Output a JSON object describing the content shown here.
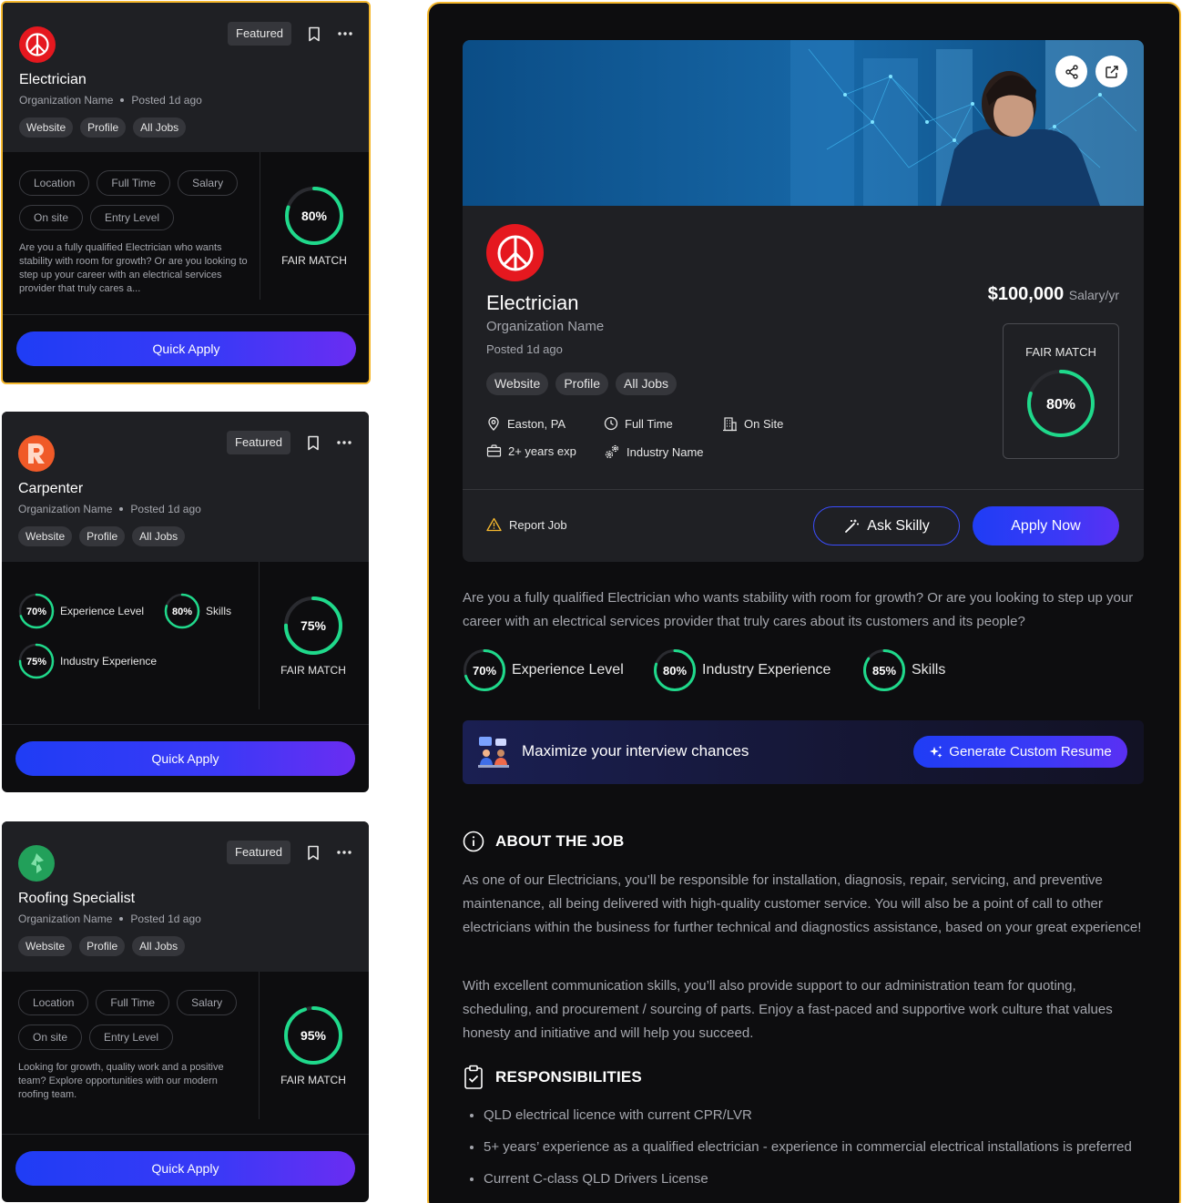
{
  "cards": [
    {
      "title": "Electrician",
      "org": "Organization Name",
      "posted": "Posted 1d ago",
      "featured": "Featured",
      "links": [
        "Website",
        "Profile",
        "All Jobs"
      ],
      "pills": [
        "Location",
        "Full Time",
        "Salary",
        "On site",
        "Entry Level"
      ],
      "description": "Are you a fully qualified Electrician who wants stability with room for growth? Or are you looking to step up your career with an electrical services provider that truly cares a...",
      "match_value": "80%",
      "match_fraction": 0.8,
      "match_label": "FAIR MATCH",
      "button": "Quick Apply",
      "logo_color": "#e5181f"
    },
    {
      "title": "Carpenter",
      "org": "Organization Name",
      "posted": "Posted 1d ago",
      "featured": "Featured",
      "links": [
        "Website",
        "Profile",
        "All Jobs"
      ],
      "skills": [
        {
          "value": "70%",
          "fraction": 0.7,
          "label": "Experience Level"
        },
        {
          "value": "80%",
          "fraction": 0.8,
          "label": "Skills"
        },
        {
          "value": "75%",
          "fraction": 0.75,
          "label": "Industry Experience"
        }
      ],
      "match_value": "75%",
      "match_fraction": 0.75,
      "match_label": "FAIR MATCH",
      "button": "Quick Apply",
      "logo_color": "#f05a28"
    },
    {
      "title": "Roofing Specialist",
      "org": "Organization Name",
      "posted": "Posted 1d ago",
      "featured": "Featured",
      "links": [
        "Website",
        "Profile",
        "All Jobs"
      ],
      "pills": [
        "Location",
        "Full Time",
        "Salary",
        "On site",
        "Entry Level"
      ],
      "description": "Looking for growth, quality work and a positive team? Explore opportunities with our modern roofing team.",
      "match_value": "95%",
      "match_fraction": 0.95,
      "match_label": "FAIR MATCH",
      "button": "Quick Apply",
      "logo_color": "#22a05a"
    }
  ],
  "detail": {
    "title": "Electrician",
    "org": "Organization Name",
    "posted": "Posted 1d ago",
    "links": [
      "Website",
      "Profile",
      "All Jobs"
    ],
    "salary": "$100,000",
    "salary_unit": "Salary/yr",
    "location": "Easton, PA",
    "job_type": "Full Time",
    "site": "On Site",
    "experience": "2+ years exp",
    "industry": "Industry Name",
    "match_label": "FAIR MATCH",
    "match_value": "80%",
    "match_fraction": 0.8,
    "report": "Report Job",
    "ask": "Ask Skilly",
    "apply": "Apply Now",
    "description": "Are you a fully qualified Electrician who wants stability with room for growth? Or are you looking to step up your career with an electrical services provider that truly cares about its customers and its people?",
    "skills": [
      {
        "value": "70%",
        "fraction": 0.7,
        "label": "Experience Level"
      },
      {
        "value": "80%",
        "fraction": 0.8,
        "label": "Industry Experience"
      },
      {
        "value": "85%",
        "fraction": 0.85,
        "label": "Skills"
      }
    ],
    "promo_text": "Maximize your interview chances",
    "promo_button": "Generate Custom Resume",
    "about_heading": "ABOUT THE JOB",
    "about_p1": "As one of our Electricians, you’ll be responsible for installation, diagnosis, repair, servicing, and preventive maintenance, all being delivered with high-quality customer service. You will also be a point of call to other electricians within the business for further technical and diagnostics assistance, based on your great experience!",
    "about_p2": "With excellent communication skills, you’ll also provide support to our administration team for quoting, scheduling, and procurement / sourcing of parts. Enjoy a fast-paced and supportive work culture that values honesty and initiative and will help you succeed.",
    "resp_heading": "RESPONSIBILITIES",
    "responsibilities": [
      "QLD electrical licence with current CPR/LVR",
      "5+ years’ experience as a qualified electrician - experience in commercial electrical installations is preferred",
      "Current C-class QLD Drivers License"
    ]
  },
  "colors": {
    "accent_border": "#f5b82e",
    "match_ring": "#1fd98b",
    "primary_button": "#1f3df5"
  },
  "icons": [
    "peace-icon",
    "bookmark-icon",
    "more-icon",
    "share-icon",
    "external-link-icon",
    "location-pin-icon",
    "clock-icon",
    "building-icon",
    "briefcase-icon",
    "gears-icon",
    "warning-icon",
    "magic-wand-icon",
    "sparkle-icon",
    "info-icon",
    "clipboard-check-icon"
  ]
}
